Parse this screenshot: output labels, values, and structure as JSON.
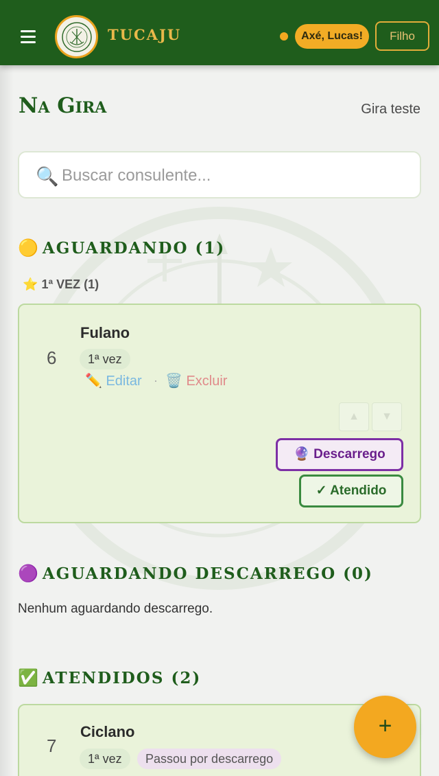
{
  "header": {
    "brand": "TUCAJU",
    "greeting": "Axé, Lucas!",
    "role": "Filho"
  },
  "page": {
    "title": "Na Gira",
    "gira_name": "Gira teste"
  },
  "search": {
    "placeholder": "Buscar consulente..."
  },
  "sections": {
    "waiting": {
      "emoji": "🟡",
      "label": "AGUARDANDO (1)"
    },
    "first_time": {
      "emoji": "⭐",
      "label": "1ª VEZ (1)"
    },
    "waiting_descarrego": {
      "emoji": "🟣",
      "label": "AGUARDANDO DESCARREGO (0)",
      "empty": "Nenhum aguardando descarrego."
    },
    "attended": {
      "emoji": "✅",
      "label": "ATENDIDOS (2)"
    }
  },
  "waiting_card": {
    "number": "6",
    "name": "Fulano",
    "tag": "1ª vez",
    "edit_label": "✏️ Editar",
    "separator": "·",
    "delete_label": "🗑️ Excluir",
    "up_label": "▲",
    "down_label": "▼",
    "descarrego_label": "🔮 Descarrego",
    "atendido_label": "✓ Atendido"
  },
  "attended_card": {
    "number": "7",
    "name": "Ciclano",
    "tag": "1ª vez",
    "tag2": "Passou por descarrego"
  },
  "fab": {
    "label": "+"
  },
  "colors": {
    "header_bg": "#1f5d1c",
    "accent": "#f3a820",
    "brand_text": "#e9b84a",
    "card_bg": "#eaf3da",
    "descarrego": "#7d2fa5",
    "atendido": "#3a8a40"
  }
}
